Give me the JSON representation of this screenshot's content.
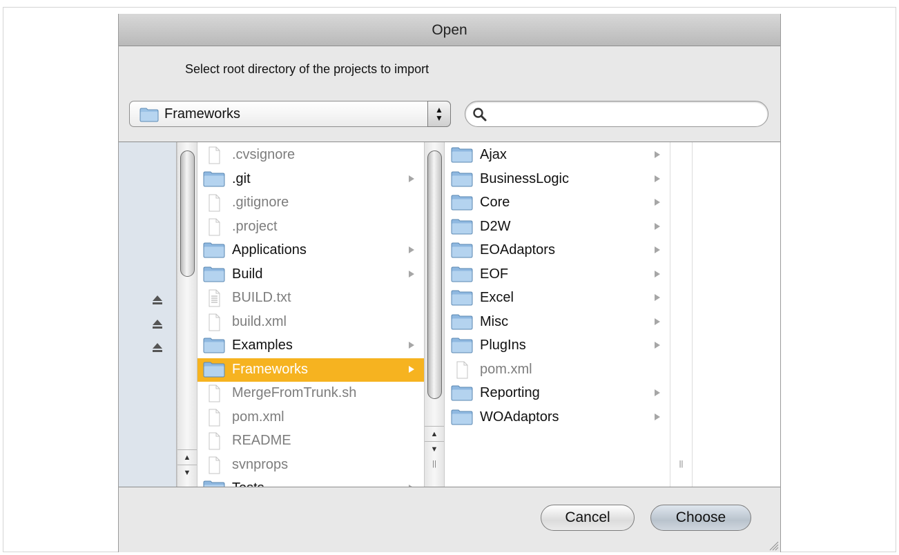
{
  "dialog": {
    "title": "Open",
    "prompt": "Select root directory of the projects to import"
  },
  "location": {
    "selected": "Frameworks",
    "icon": "folder-icon"
  },
  "search": {
    "value": "",
    "placeholder": "",
    "icon": "magnifier-icon"
  },
  "sidebar": {
    "eject_icons": [
      "eject-icon",
      "eject-icon",
      "eject-icon"
    ]
  },
  "column1": {
    "items": [
      {
        "name": ".cvsignore",
        "kind": "file"
      },
      {
        "name": ".git",
        "kind": "folder"
      },
      {
        "name": ".gitignore",
        "kind": "file"
      },
      {
        "name": ".project",
        "kind": "file"
      },
      {
        "name": "Applications",
        "kind": "folder"
      },
      {
        "name": "Build",
        "kind": "folder"
      },
      {
        "name": "BUILD.txt",
        "kind": "text-file"
      },
      {
        "name": "build.xml",
        "kind": "file"
      },
      {
        "name": "Examples",
        "kind": "folder"
      },
      {
        "name": "Frameworks",
        "kind": "folder",
        "selected": true
      },
      {
        "name": "MergeFromTrunk.sh",
        "kind": "file"
      },
      {
        "name": "pom.xml",
        "kind": "file"
      },
      {
        "name": "README",
        "kind": "file"
      },
      {
        "name": "svnprops",
        "kind": "file"
      },
      {
        "name": "Tests",
        "kind": "folder"
      }
    ]
  },
  "column2": {
    "items": [
      {
        "name": "Ajax",
        "kind": "folder"
      },
      {
        "name": "BusinessLogic",
        "kind": "folder"
      },
      {
        "name": "Core",
        "kind": "folder"
      },
      {
        "name": "D2W",
        "kind": "folder"
      },
      {
        "name": "EOAdaptors",
        "kind": "folder"
      },
      {
        "name": "EOF",
        "kind": "folder"
      },
      {
        "name": "Excel",
        "kind": "folder"
      },
      {
        "name": "Misc",
        "kind": "folder"
      },
      {
        "name": "PlugIns",
        "kind": "folder"
      },
      {
        "name": "pom.xml",
        "kind": "file"
      },
      {
        "name": "Reporting",
        "kind": "folder"
      },
      {
        "name": "WOAdaptors",
        "kind": "folder"
      }
    ]
  },
  "buttons": {
    "cancel": "Cancel",
    "choose": "Choose"
  },
  "colors": {
    "selection": "#f6b320",
    "folder": "#8fb8e0",
    "sidebar": "#dde4ec"
  }
}
